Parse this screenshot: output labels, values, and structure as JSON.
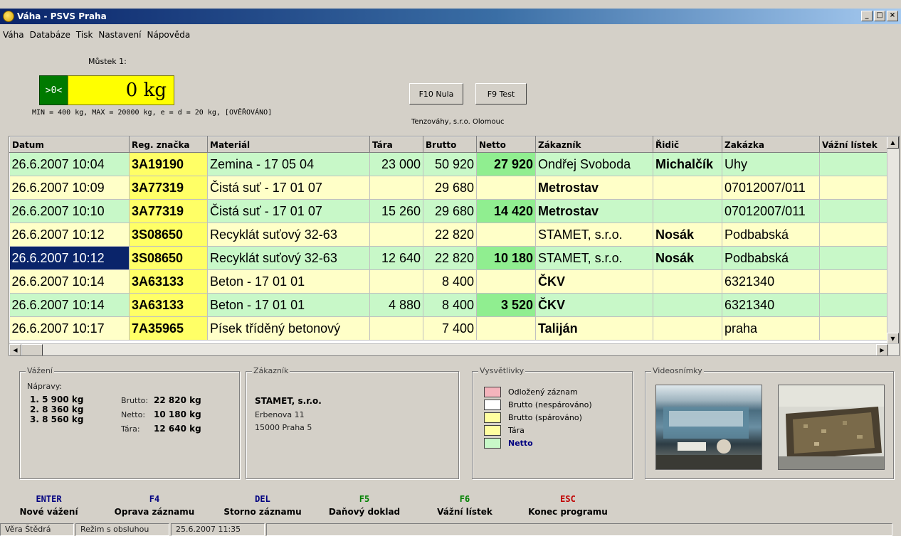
{
  "window": {
    "title": "Váha - PSVS Praha",
    "minimize": "_",
    "maximize": "□",
    "close": "×"
  },
  "menu": [
    "Váha",
    "Databáze",
    "Tisk",
    "Nastavení",
    "Nápověda"
  ],
  "scale": {
    "bridge_label": "Můstek 1:",
    "zero_indicator": ">0<",
    "weight": "0 kg",
    "spec": "MIN = 400 kg, MAX = 20000 kg, e = d = 20 kg, [OVĚŘOVÁNO]",
    "btn_zero": "F10 Nula",
    "btn_test": "F9 Test",
    "company": "Tenzováhy, s.r.o. Olomouc"
  },
  "table": {
    "columns": [
      "Datum",
      "Reg. značka",
      "Materiál",
      "Tára",
      "Brutto",
      "Netto",
      "Zákazník",
      "Řidič",
      "Zakázka",
      "Vážní lístek"
    ],
    "rows": [
      {
        "color": "g",
        "datum": "26.6.2007 10:04",
        "reg": "3A19190",
        "material": "Zemina - 17 05 04",
        "tara": "23 000",
        "brutto": "50 920",
        "netto": "27 920",
        "zakaznik": "Ondřej Svoboda",
        "ridic": "Michalčík",
        "zakazka": "Uhy",
        "listek": ""
      },
      {
        "color": "y",
        "datum": "26.6.2007 10:09",
        "reg": "3A77319",
        "material": "Čistá suť - 17 01 07",
        "tara": "",
        "brutto": "29 680",
        "netto": "",
        "zakaznik": "Metrostav",
        "ridic": "",
        "zakazka": "07012007/011",
        "listek": ""
      },
      {
        "color": "g",
        "datum": "26.6.2007 10:10",
        "reg": "3A77319",
        "material": "Čistá suť - 17 01 07",
        "tara": "15 260",
        "brutto": "29 680",
        "netto": "14 420",
        "zakaznik": "Metrostav",
        "ridic": "",
        "zakazka": "07012007/011",
        "listek": ""
      },
      {
        "color": "y",
        "datum": "26.6.2007 10:12",
        "reg": "3S08650",
        "material": "Recyklát suťový 32-63",
        "tara": "",
        "brutto": "22 820",
        "netto": "",
        "zakaznik": "STAMET, s.r.o.",
        "ridic": "Nosák",
        "zakazka": "Podbabská",
        "listek": ""
      },
      {
        "color": "g",
        "selected": true,
        "datum": "26.6.2007 10:12",
        "reg": "3S08650",
        "material": "Recyklát suťový 32-63",
        "tara": "12 640",
        "brutto": "22 820",
        "netto": "10 180",
        "zakaznik": "STAMET, s.r.o.",
        "ridic": "Nosák",
        "zakazka": "Podbabská",
        "listek": ""
      },
      {
        "color": "y",
        "datum": "26.6.2007 10:14",
        "reg": "3A63133",
        "material": "Beton - 17 01 01",
        "tara": "",
        "brutto": "8 400",
        "netto": "",
        "zakaznik": "ČKV",
        "ridic": "",
        "zakazka": "6321340",
        "listek": ""
      },
      {
        "color": "g",
        "datum": "26.6.2007 10:14",
        "reg": "3A63133",
        "material": "Beton - 17 01 01",
        "tara": "4 880",
        "brutto": "8 400",
        "netto": "3 520",
        "zakaznik": "ČKV",
        "ridic": "",
        "zakazka": "6321340",
        "listek": ""
      },
      {
        "color": "y",
        "datum": "26.6.2007 10:17",
        "reg": "7A35965",
        "material": "Písek tříděný betonový",
        "tara": "",
        "brutto": "7 400",
        "netto": "",
        "zakaznik": "Taliján",
        "ridic": "",
        "zakazka": "praha",
        "listek": ""
      }
    ]
  },
  "vazeni": {
    "title": "Vážení",
    "napravy_label": "Nápravy:",
    "axles": [
      "1.  5 900 kg",
      "2.  8 360 kg",
      "3.  8 560 kg"
    ],
    "brutto_label": "Brutto:",
    "brutto": "22 820 kg",
    "netto_label": "Netto:",
    "netto": "10 180 kg",
    "tara_label": "Tára:",
    "tara": "12 640 kg"
  },
  "zakaznik": {
    "title": "Zákazník",
    "name": "STAMET, s.r.o.",
    "street": "Erbenova 11",
    "city": "15000 Praha 5"
  },
  "legend": {
    "title": "Vysvětlivky",
    "items": [
      {
        "label": "Odložený záznam",
        "color": "#f4b4bc"
      },
      {
        "label": "Brutto (nespárováno)",
        "color": "#ffffff"
      },
      {
        "label": "Brutto (spárováno)",
        "color": "#ffffa0"
      },
      {
        "label": "Tára",
        "color": "#ffffa0"
      },
      {
        "label": "Netto",
        "color": "#c8f8c8"
      }
    ]
  },
  "video": {
    "title": "Videosnímky"
  },
  "toolbar": [
    {
      "key": "ENTER",
      "label": "Nové vážení",
      "color": "#000080"
    },
    {
      "key": "F4",
      "label": "Oprava záznamu",
      "color": "#000080"
    },
    {
      "key": "DEL",
      "label": "Storno záznamu",
      "color": "#000080"
    },
    {
      "key": "F5",
      "label": "Daňový doklad",
      "color": "#008000"
    },
    {
      "key": "F6",
      "label": "Vážní lístek",
      "color": "#008000"
    },
    {
      "key": "ESC",
      "label": "Konec programu",
      "color": "#c00000"
    }
  ],
  "status": {
    "user": "Věra Štědrá",
    "mode": "Režim s obsluhou",
    "datetime": "25.6.2007 11:35"
  }
}
